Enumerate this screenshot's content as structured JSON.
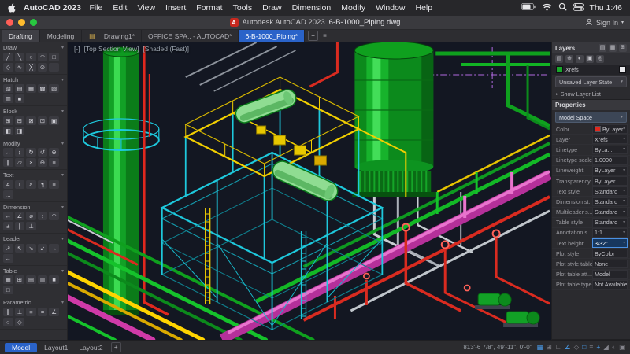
{
  "glyphs": {
    "chevron_down": "▾",
    "chevron_right": "▸",
    "plus": "+",
    "overflow_menu": "≡",
    "file_tab": "▤"
  },
  "palette": {
    "viewport_background": "#131722",
    "structure_cyan": "#1ec8dc",
    "frame_yellow": "#f2cf00",
    "pipe_green": "#15c22b",
    "tank_green": "#0c8a1c",
    "pipe_red": "#e0281e",
    "pipe_magenta": "#d13bb0",
    "pipe_white": "#c8cdd2",
    "centerline_violet": "#b06ae0",
    "accent_blue": "#2a63c9"
  },
  "menubar": {
    "app_name": "AutoCAD 2023",
    "items": [
      "File",
      "Edit",
      "View",
      "Insert",
      "Format",
      "Tools",
      "Draw",
      "Dimension",
      "Modify",
      "Window",
      "Help"
    ],
    "clock": "Thu 1:46"
  },
  "titlebar": {
    "app_icon_letter": "A",
    "app_title": "Autodesk AutoCAD 2023",
    "doc_name": "6-B-1000_Piping.dwg",
    "sign_in": "Sign In"
  },
  "ribbon": {
    "workspace_tabs": [
      {
        "label": "Drafting",
        "active": true
      },
      {
        "label": "Modeling",
        "active": false
      }
    ],
    "drawing_tabs": [
      {
        "label": "Drawing1*",
        "active": false
      },
      {
        "label": "OFFICE SPA.. - AUTOCAD*",
        "active": false
      },
      {
        "label": "6-B-1000_Piping*",
        "active": true
      }
    ]
  },
  "toolbox": {
    "sections": [
      {
        "label": "Draw",
        "tools": [
          {
            "name": "line-icon",
            "glyph": "╱"
          },
          {
            "name": "polyline-icon",
            "glyph": "╲"
          },
          {
            "name": "circle-icon",
            "glyph": "○"
          },
          {
            "name": "arc-icon",
            "glyph": "◠"
          },
          {
            "name": "rectangle-icon",
            "glyph": "□"
          },
          {
            "name": "polygon-icon",
            "glyph": "◇"
          },
          {
            "name": "spline-icon",
            "glyph": "∿"
          },
          {
            "name": "construction-line-icon",
            "glyph": "╳"
          },
          {
            "name": "donut-icon",
            "glyph": "⊙"
          },
          {
            "name": "point-icon",
            "glyph": "·"
          }
        ]
      },
      {
        "label": "Hatch",
        "tools": [
          {
            "name": "hatch-pattern-icon",
            "glyph": "▨"
          },
          {
            "name": "hatch-horizontal-icon",
            "glyph": "▤"
          },
          {
            "name": "hatch-grid-icon",
            "glyph": "▦"
          },
          {
            "name": "hatch-crosshatch-icon",
            "glyph": "▩"
          },
          {
            "name": "hatch-diagonal-icon",
            "glyph": "▧"
          },
          {
            "name": "hatch-vertical-icon",
            "glyph": "▥"
          },
          {
            "name": "solid-fill-icon",
            "glyph": "■"
          }
        ]
      },
      {
        "label": "Block",
        "tools": [
          {
            "name": "insert-block-icon",
            "glyph": "⊞"
          },
          {
            "name": "create-block-icon",
            "glyph": "⊟"
          },
          {
            "name": "edit-block-icon",
            "glyph": "⊠"
          },
          {
            "name": "write-block-icon",
            "glyph": "⊡"
          },
          {
            "name": "attribute-icon",
            "glyph": "▣"
          },
          {
            "name": "base-point-icon",
            "glyph": "◧"
          },
          {
            "name": "block-editor-icon",
            "glyph": "◨"
          }
        ]
      },
      {
        "label": "Modify",
        "tools": [
          {
            "name": "move-icon",
            "glyph": "↔"
          },
          {
            "name": "stretch-icon",
            "glyph": "↕"
          },
          {
            "name": "rotate-icon",
            "glyph": "↻"
          },
          {
            "name": "mirror-icon",
            "glyph": "↺"
          },
          {
            "name": "array-icon",
            "glyph": "⊕"
          },
          {
            "name": "offset-icon",
            "glyph": "∥"
          },
          {
            "name": "scale-icon",
            "glyph": "▱"
          },
          {
            "name": "erase-icon",
            "glyph": "×"
          },
          {
            "name": "trim-icon",
            "glyph": "⊖"
          },
          {
            "name": "match-properties-icon",
            "glyph": "≡"
          }
        ]
      },
      {
        "label": "Text",
        "tools": [
          {
            "name": "multiline-text-icon",
            "glyph": "A"
          },
          {
            "name": "single-line-text-icon",
            "glyph": "T"
          },
          {
            "name": "field-icon",
            "glyph": "a"
          },
          {
            "name": "paragraph-icon",
            "glyph": "¶"
          },
          {
            "name": "justify-icon",
            "glyph": "≡"
          },
          {
            "name": "more-text-tools-icon",
            "glyph": "…"
          }
        ]
      },
      {
        "label": "Dimension",
        "tools": [
          {
            "name": "linear-dimension-icon",
            "glyph": "↔"
          },
          {
            "name": "angular-dimension-icon",
            "glyph": "∠"
          },
          {
            "name": "diameter-dimension-icon",
            "glyph": "⌀"
          },
          {
            "name": "vertical-dimension-icon",
            "glyph": "↕"
          },
          {
            "name": "arc-length-icon",
            "glyph": "◠"
          },
          {
            "name": "tolerance-icon",
            "glyph": "±"
          },
          {
            "name": "baseline-dimension-icon",
            "glyph": "∥"
          },
          {
            "name": "ordinate-dimension-icon",
            "glyph": "⊥"
          }
        ]
      },
      {
        "label": "Leader",
        "tools": [
          {
            "name": "multileader-icon",
            "glyph": "↗"
          },
          {
            "name": "leader-up-left-icon",
            "glyph": "↖"
          },
          {
            "name": "leader-down-right-icon",
            "glyph": "↘"
          },
          {
            "name": "leader-down-left-icon",
            "glyph": "↙"
          },
          {
            "name": "leader-right-icon",
            "glyph": "→"
          },
          {
            "name": "leader-left-icon",
            "glyph": "←"
          }
        ]
      },
      {
        "label": "Table",
        "tools": [
          {
            "name": "table-icon",
            "glyph": "▦"
          },
          {
            "name": "insert-table-icon",
            "glyph": "⊞"
          },
          {
            "name": "table-row-icon",
            "glyph": "▤"
          },
          {
            "name": "table-column-icon",
            "glyph": "▥"
          },
          {
            "name": "cell-fill-icon",
            "glyph": "■"
          },
          {
            "name": "cell-empty-icon",
            "glyph": "□"
          }
        ]
      },
      {
        "label": "Parametric",
        "tools": [
          {
            "name": "parallel-constraint-icon",
            "glyph": "∥"
          },
          {
            "name": "perpendicular-constraint-icon",
            "glyph": "⊥"
          },
          {
            "name": "equal-constraint-icon",
            "glyph": "≡"
          },
          {
            "name": "coincident-constraint-icon",
            "glyph": "="
          },
          {
            "name": "angular-constraint-icon",
            "glyph": "∠"
          },
          {
            "name": "concentric-constraint-icon",
            "glyph": "○"
          },
          {
            "name": "symmetric-constraint-icon",
            "glyph": "◇"
          }
        ]
      }
    ]
  },
  "viewport": {
    "controls": [
      "[-]",
      "[Top Section View]",
      "[Shaded (Fast)]"
    ]
  },
  "layers_panel": {
    "title": "Layers",
    "tab_icons": [
      {
        "name": "properties-palette-tab-icon",
        "glyph": "▤"
      },
      {
        "name": "layers-palette-tab-icon",
        "glyph": "▦"
      },
      {
        "name": "blocks-palette-tab-icon",
        "glyph": "⊞"
      }
    ],
    "toolbar_icons": [
      {
        "name": "layer-properties-icon",
        "glyph": "▤"
      },
      {
        "name": "new-layer-icon",
        "glyph": "⊕"
      },
      {
        "name": "layer-freeze-icon",
        "glyph": "◐"
      },
      {
        "name": "layer-lock-icon",
        "glyph": "▣"
      },
      {
        "name": "layer-isolate-icon",
        "glyph": "◎"
      }
    ],
    "layer_item": {
      "label": "Xrefs"
    },
    "layer_state": "Unsaved Layer State",
    "show_layer_list": "Show Layer List"
  },
  "properties_panel": {
    "title": "Properties",
    "selection": "Model Space",
    "rows": [
      {
        "label": "Color",
        "value": "ByLayer",
        "swatch": "#e0281e",
        "dropdown": true
      },
      {
        "label": "Layer",
        "value": "Xrefs",
        "dropdown": true
      },
      {
        "label": "Linetype",
        "value": "ByLa...",
        "dropdown": true
      },
      {
        "label": "Linetype scale",
        "value": "1.0000"
      },
      {
        "label": "Lineweight",
        "value": "ByLayer",
        "dropdown": true
      },
      {
        "label": "Transparency",
        "value": "ByLayer"
      },
      {
        "label": "Text style",
        "value": "Standard",
        "dropdown": true
      },
      {
        "label": "Dimension st...",
        "value": "Standard",
        "dropdown": true
      },
      {
        "label": "Multileader s...",
        "value": "Standard",
        "dropdown": true
      },
      {
        "label": "Table style",
        "value": "Standard",
        "dropdown": true
      },
      {
        "label": "Annotation s...",
        "value": "1:1",
        "dropdown": true
      },
      {
        "label": "Text height",
        "value": "3/32\"",
        "dropdown": true,
        "highlight": true
      },
      {
        "label": "Plot style",
        "value": "ByColor"
      },
      {
        "label": "Plot style table",
        "value": "None"
      },
      {
        "label": "Plot table att...",
        "value": "Model"
      },
      {
        "label": "Plot table type",
        "value": "Not Available"
      }
    ]
  },
  "statusbar": {
    "model_tab": "Model",
    "layout_tabs": [
      "Layout1",
      "Layout2"
    ],
    "coordinates": "813'-6 7/8\", 49'-11\", 0'-0\"",
    "icons": [
      {
        "name": "grid-display-icon",
        "glyph": "▦",
        "active": true
      },
      {
        "name": "snap-mode-icon",
        "glyph": "⊞",
        "active": false
      },
      {
        "name": "ortho-mode-icon",
        "glyph": "∟",
        "active": false
      },
      {
        "name": "polar-tracking-icon",
        "glyph": "∠",
        "active": true
      },
      {
        "name": "isodraft-icon",
        "glyph": "◇",
        "active": false
      },
      {
        "name": "object-snap-icon",
        "glyph": "□",
        "active": true
      },
      {
        "name": "lineweight-display-icon",
        "glyph": "≡",
        "active": false
      },
      {
        "name": "dynamic-input-icon",
        "glyph": "+",
        "active": true
      },
      {
        "name": "annotation-visibility-icon",
        "glyph": "◢",
        "active": false
      },
      {
        "name": "workspace-switch-icon",
        "glyph": "◐",
        "active": false
      },
      {
        "name": "full-screen-icon",
        "glyph": "▣",
        "active": false
      }
    ]
  }
}
